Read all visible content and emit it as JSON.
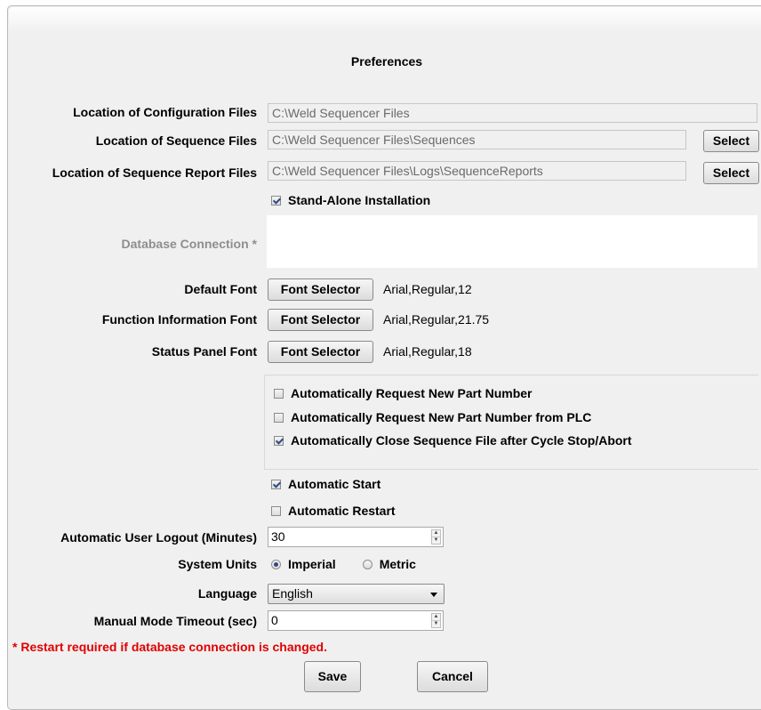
{
  "dialog": {
    "title": "Preferences"
  },
  "paths": {
    "config_label": "Location of Configuration Files",
    "config_value": "C:\\Weld Sequencer Files",
    "sequence_label": "Location of Sequence Files",
    "sequence_value": "C:\\Weld Sequencer Files\\Sequences",
    "report_label": "Location of Sequence Report Files",
    "report_value": "C:\\Weld Sequencer Files\\Logs\\SequenceReports",
    "select_label": "Select"
  },
  "standalone": {
    "label": "Stand-Alone Installation",
    "checked": true
  },
  "database": {
    "label": "Database Connection *",
    "value": ""
  },
  "fonts": {
    "button_label": "Font Selector",
    "default_label": "Default Font",
    "default_value": "Arial,Regular,12",
    "function_label": "Function Information Font",
    "function_value": "Arial,Regular,21.75",
    "status_label": "Status Panel Font",
    "status_value": "Arial,Regular,18"
  },
  "part_options": [
    {
      "label": "Automatically Request New Part Number",
      "checked": false
    },
    {
      "label": "Automatically Request New Part Number from PLC",
      "checked": false
    },
    {
      "label": "Automatically Close Sequence File after Cycle Stop/Abort",
      "checked": true
    }
  ],
  "auto_start": {
    "label": "Automatic Start",
    "checked": true
  },
  "auto_restart": {
    "label": "Automatic Restart",
    "checked": false
  },
  "logout": {
    "label": "Automatic User Logout (Minutes)",
    "value": "30"
  },
  "units": {
    "label": "System Units",
    "options": [
      "Imperial",
      "Metric"
    ],
    "selected": "Imperial"
  },
  "language": {
    "label": "Language",
    "value": "English"
  },
  "manual_timeout": {
    "label": "Manual Mode Timeout (sec)",
    "value": "0"
  },
  "warning": "* Restart required if database connection is changed.",
  "actions": {
    "save": "Save",
    "cancel": "Cancel"
  }
}
